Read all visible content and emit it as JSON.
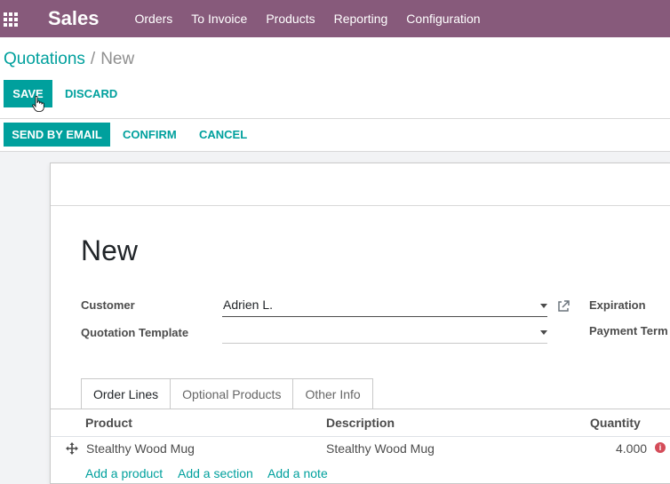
{
  "navbar": {
    "app_name": "Sales",
    "menu": [
      "Orders",
      "To Invoice",
      "Products",
      "Reporting",
      "Configuration"
    ]
  },
  "breadcrumb": {
    "parent": "Quotations",
    "separator": "/",
    "current": "New"
  },
  "actions": {
    "save": "SAVE",
    "discard": "DISCARD"
  },
  "statusbar": {
    "send_email": "SEND BY EMAIL",
    "confirm": "CONFIRM",
    "cancel": "CANCEL"
  },
  "form": {
    "title": "New",
    "customer_label": "Customer",
    "customer_value": "Adrien L.",
    "template_label": "Quotation Template",
    "template_value": "",
    "expiration_label": "Expiration",
    "payment_terms_label": "Payment Term"
  },
  "tabs": [
    "Order Lines",
    "Optional Products",
    "Other Info"
  ],
  "order_lines": {
    "columns": [
      "Product",
      "Description",
      "Quantity"
    ],
    "rows": [
      {
        "product": "Stealthy Wood Mug",
        "description": "Stealthy Wood Mug",
        "quantity": "4.000"
      }
    ],
    "add_links": [
      "Add a product",
      "Add a section",
      "Add a note"
    ]
  },
  "colors": {
    "navbar": "#875a7b",
    "primary": "#00a09d",
    "warning": "#d44c59"
  },
  "icons": {
    "apps": "apps-grid-icon",
    "external": "external-link-icon",
    "drag": "drag-handle-icon",
    "warning": "info-warning-icon",
    "cursor": "hand-pointer-icon"
  }
}
